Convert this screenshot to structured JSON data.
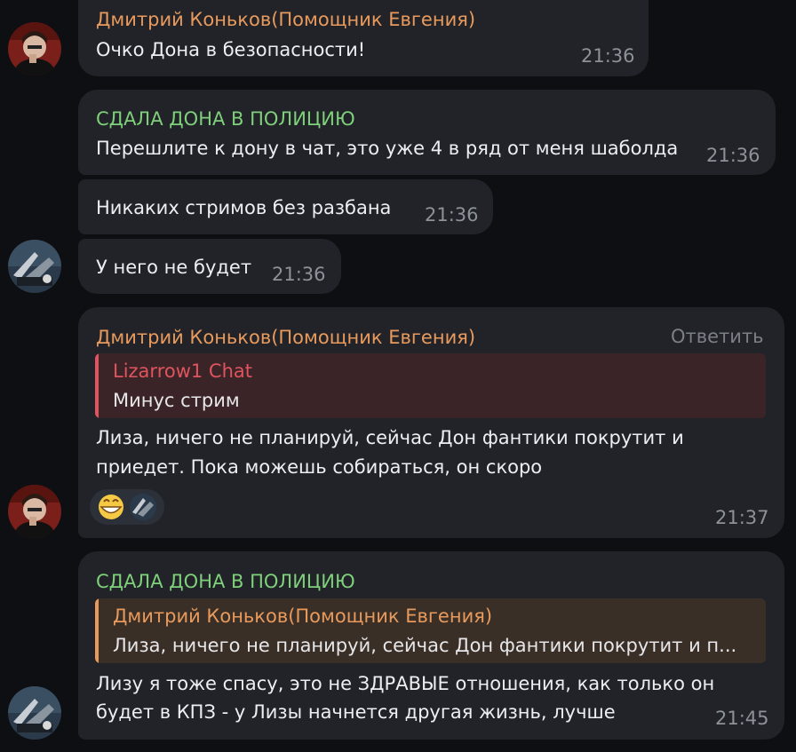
{
  "colors": {
    "background": "#0e0f13",
    "bubble": "#212329",
    "sender_orange": "#e89a5c",
    "sender_green": "#7fd07a",
    "quote_red": "#e0545e",
    "quote_orange": "#e89a5c"
  },
  "messages": [
    {
      "sender": "Дмитрий Коньков(Помощник Евгения)",
      "text": "Очко Дона в безопасности!",
      "time": "21:36"
    },
    {
      "sender": "СДАЛА ДОНА В ПОЛИЦИЮ",
      "text": "Перешлите к дону в чат, это уже 4 в ряд от меня шаболда",
      "time": "21:36"
    },
    {
      "text": "Никаких стримов без разбана",
      "time": "21:36"
    },
    {
      "text": "У него не будет",
      "time": "21:36"
    },
    {
      "sender": "Дмитрий Коньков(Помощник Евгения)",
      "reply_action": "Ответить",
      "quote": {
        "name": "Lizarrow1 Chat",
        "text": "Минус стрим"
      },
      "lines": [
        "Лиза, ничего не планируй, сейчас Дон фантики покрутит и",
        "приедет. Пока можешь собираться, он скоро"
      ],
      "reactions": [
        "grinning-face-emoji",
        "user-avatar-reaction"
      ],
      "time": "21:37"
    },
    {
      "sender": "СДАЛА ДОНА В ПОЛИЦИЮ",
      "quote": {
        "name": "Дмитрий Коньков(Помощник Евгения)",
        "text": "Лиза, ничего не планируй, сейчас Дон фантики покрутит и п..."
      },
      "lines": [
        "Лизу я тоже спасу, это не ЗДРАВЫЕ отношения, как только он",
        "будет в КПЗ - у Лизы начнется другая жизнь, лучше"
      ],
      "time": "21:45"
    }
  ]
}
